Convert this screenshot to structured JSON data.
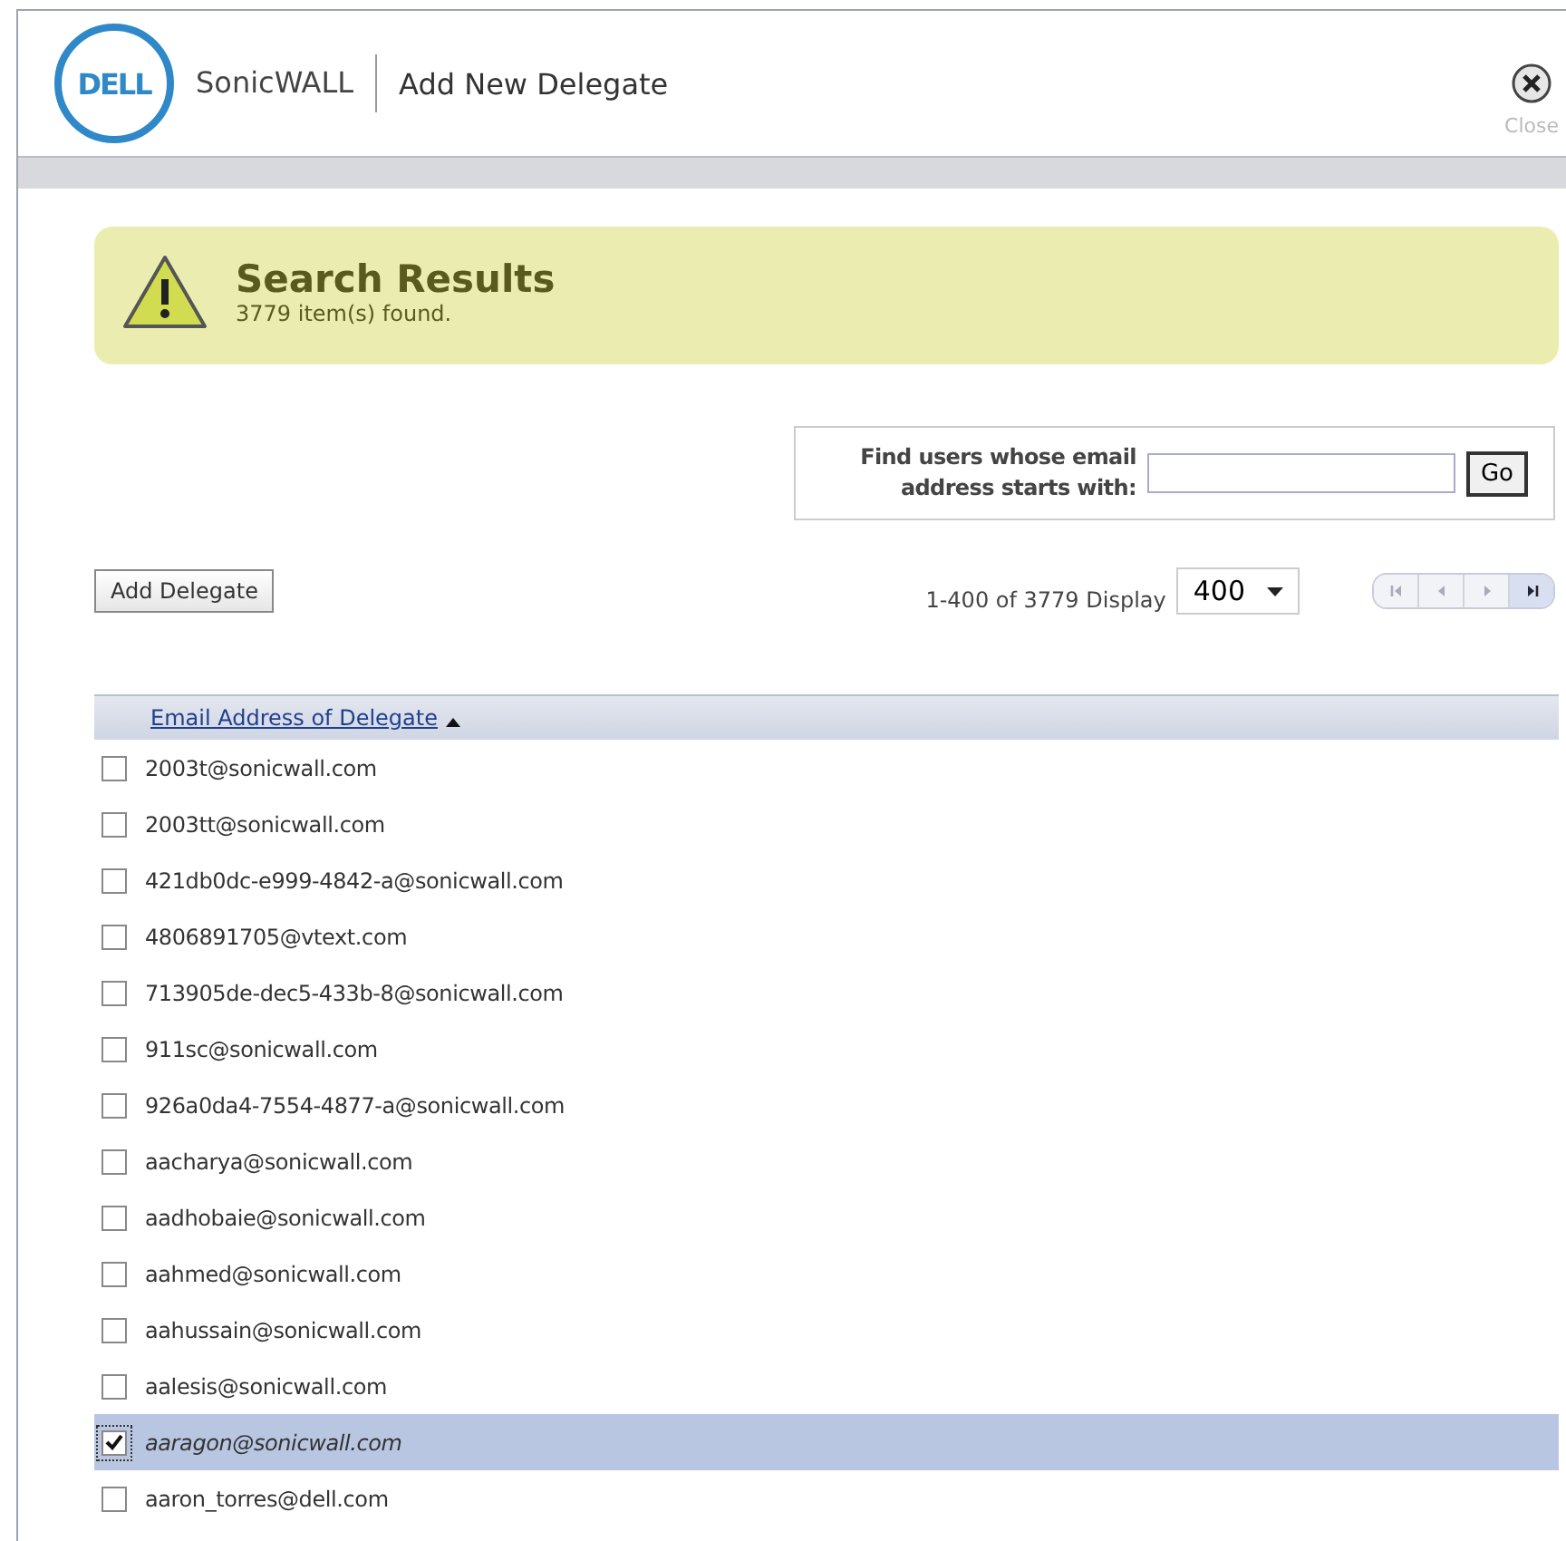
{
  "header": {
    "logo": "DELL",
    "brand": "SonicWALL",
    "title": "Add New Delegate",
    "close_label": "Close"
  },
  "alert": {
    "title": "Search Results",
    "message": "3779 item(s) found."
  },
  "search": {
    "label": "Find users whose email address starts with:",
    "button": "Go"
  },
  "toolbar": {
    "add_button": "Add Delegate",
    "range": "1-400 of 3779 Display",
    "page_size": "400",
    "pager": [
      {
        "kind": "first",
        "disabled": true
      },
      {
        "kind": "prev",
        "disabled": true
      },
      {
        "kind": "next",
        "disabled": true
      },
      {
        "kind": "last",
        "disabled": false
      }
    ]
  },
  "table": {
    "column": "Email Address of Delegate",
    "rows": [
      {
        "email": "2003t@sonicwall.com",
        "checked": false
      },
      {
        "email": "2003tt@sonicwall.com",
        "checked": false
      },
      {
        "email": "421db0dc-e999-4842-a@sonicwall.com",
        "checked": false
      },
      {
        "email": "4806891705@vtext.com",
        "checked": false
      },
      {
        "email": "713905de-dec5-433b-8@sonicwall.com",
        "checked": false
      },
      {
        "email": "911sc@sonicwall.com",
        "checked": false
      },
      {
        "email": "926a0da4-7554-4877-a@sonicwall.com",
        "checked": false
      },
      {
        "email": "aacharya@sonicwall.com",
        "checked": false
      },
      {
        "email": "aadhobaie@sonicwall.com",
        "checked": false
      },
      {
        "email": "aahmed@sonicwall.com",
        "checked": false
      },
      {
        "email": "aahussain@sonicwall.com",
        "checked": false
      },
      {
        "email": "aalesis@sonicwall.com",
        "checked": false
      },
      {
        "email": "aaragon@sonicwall.com",
        "checked": true
      },
      {
        "email": "aaron_torres@dell.com",
        "checked": false
      }
    ]
  }
}
